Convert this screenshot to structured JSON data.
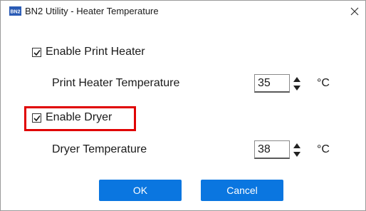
{
  "window": {
    "title": "BN2 Utility - Heater Temperature",
    "app_icon_text": "BN2",
    "close_glyph": "✕"
  },
  "print_heater": {
    "enable_label": "Enable Print Heater",
    "enabled": true,
    "temperature_label": "Print Heater Temperature",
    "temperature_value": "35",
    "unit": "°C"
  },
  "dryer": {
    "enable_label": "Enable Dryer",
    "enabled": true,
    "temperature_label": "Dryer Temperature",
    "temperature_value": "38",
    "unit": "°C",
    "highlight_color": "#e00000"
  },
  "buttons": {
    "ok_label": "OK",
    "cancel_label": "Cancel",
    "accent": "#0a76e0"
  }
}
